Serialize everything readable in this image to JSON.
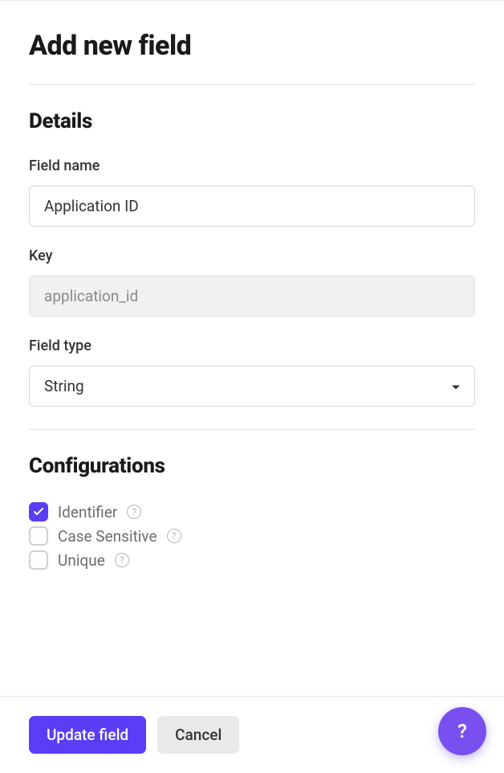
{
  "page": {
    "title": "Add new field"
  },
  "sections": {
    "details": {
      "title": "Details",
      "fieldName": {
        "label": "Field name",
        "value": "Application ID"
      },
      "key": {
        "label": "Key",
        "value": "application_id"
      },
      "fieldType": {
        "label": "Field type",
        "value": "String"
      }
    },
    "configurations": {
      "title": "Configurations",
      "items": [
        {
          "label": "Identifier",
          "checked": true
        },
        {
          "label": "Case Sensitive",
          "checked": false
        },
        {
          "label": "Unique",
          "checked": false
        }
      ]
    }
  },
  "footer": {
    "primary": "Update field",
    "secondary": "Cancel"
  },
  "fab": {
    "label": "?"
  }
}
